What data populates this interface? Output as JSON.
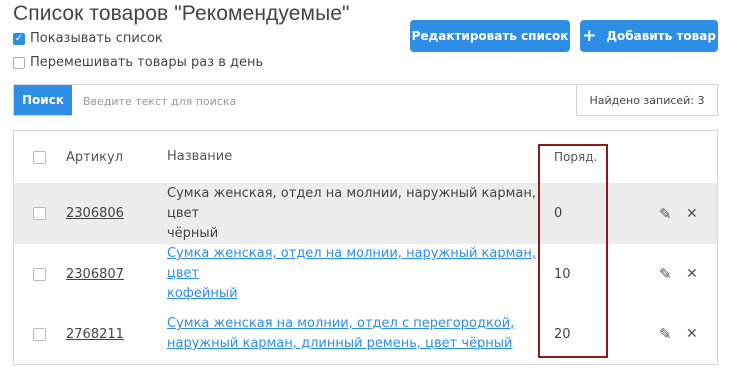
{
  "page_title": "Список товаров \"Рекомендуемые\"",
  "options": {
    "show_list": {
      "label": "Показывать список",
      "checked": true
    },
    "shuffle_daily": {
      "label": "Перемешивать товары раз в день",
      "checked": false
    }
  },
  "toolbar": {
    "edit_list_label": "Редактировать список",
    "add_product_label": "Добавить товар",
    "add_icon": "plus-icon"
  },
  "search": {
    "button_label": "Поиск",
    "placeholder": "Введите текст для поиска",
    "found_text": "Найдено записей: 3"
  },
  "table": {
    "headers": {
      "article": "Артикул",
      "name": "Название",
      "order": "Поряд."
    },
    "rows": [
      {
        "article": "2306806",
        "name_line1": "Сумка женская, отдел на молнии, наружный карман, цвет",
        "name_line2": "чёрный",
        "order": "0",
        "name_is_link": false
      },
      {
        "article": "2306807",
        "name_line1": "Сумка женская, отдел на молнии, наружный карман, цвет",
        "name_line2": "кофейный",
        "order": "10",
        "name_is_link": true
      },
      {
        "article": "2768211",
        "name_line1": "Сумка женская на молнии, отдел с перегородкой,",
        "name_line2": "наружный карман, длинный ремень, цвет чёрный",
        "order": "20",
        "name_is_link": true
      }
    ],
    "row_actions": {
      "edit_icon": "pencil-icon",
      "delete_icon": "close-icon"
    }
  },
  "colors": {
    "accent": "#2d8ee5",
    "highlight_frame": "#8b1a1a",
    "selected_row_bg": "#ececec"
  }
}
